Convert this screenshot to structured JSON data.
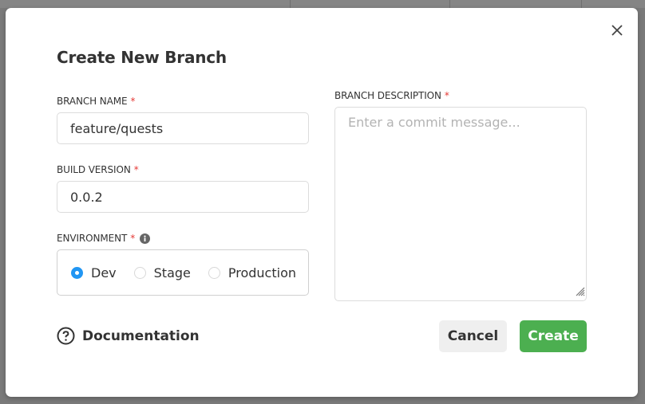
{
  "dialog": {
    "title": "Create New Branch",
    "close_icon": "close-icon"
  },
  "form": {
    "branch_name": {
      "label": "BRANCH NAME",
      "required_mark": "*",
      "value": "feature/quests"
    },
    "build_version": {
      "label": "BUILD VERSION",
      "required_mark": "*",
      "value": "0.0.2"
    },
    "environment": {
      "label": "ENVIRONMENT",
      "required_mark": "*",
      "info_icon": "info-icon",
      "options": [
        {
          "label": "Dev",
          "selected": true
        },
        {
          "label": "Stage",
          "selected": false
        },
        {
          "label": "Production",
          "selected": false
        }
      ],
      "selected": "Dev"
    },
    "branch_description": {
      "label": "BRANCH DESCRIPTION",
      "required_mark": "*",
      "value": "",
      "placeholder": "Enter a commit message..."
    }
  },
  "footer": {
    "documentation_label": "Documentation",
    "documentation_icon": "help-circle-icon",
    "cancel_label": "Cancel",
    "create_label": "Create"
  },
  "colors": {
    "accent_radio": "#2196f3",
    "create_button": "#4caf50",
    "required_mark": "#e53935",
    "cancel_button": "#efefef"
  }
}
